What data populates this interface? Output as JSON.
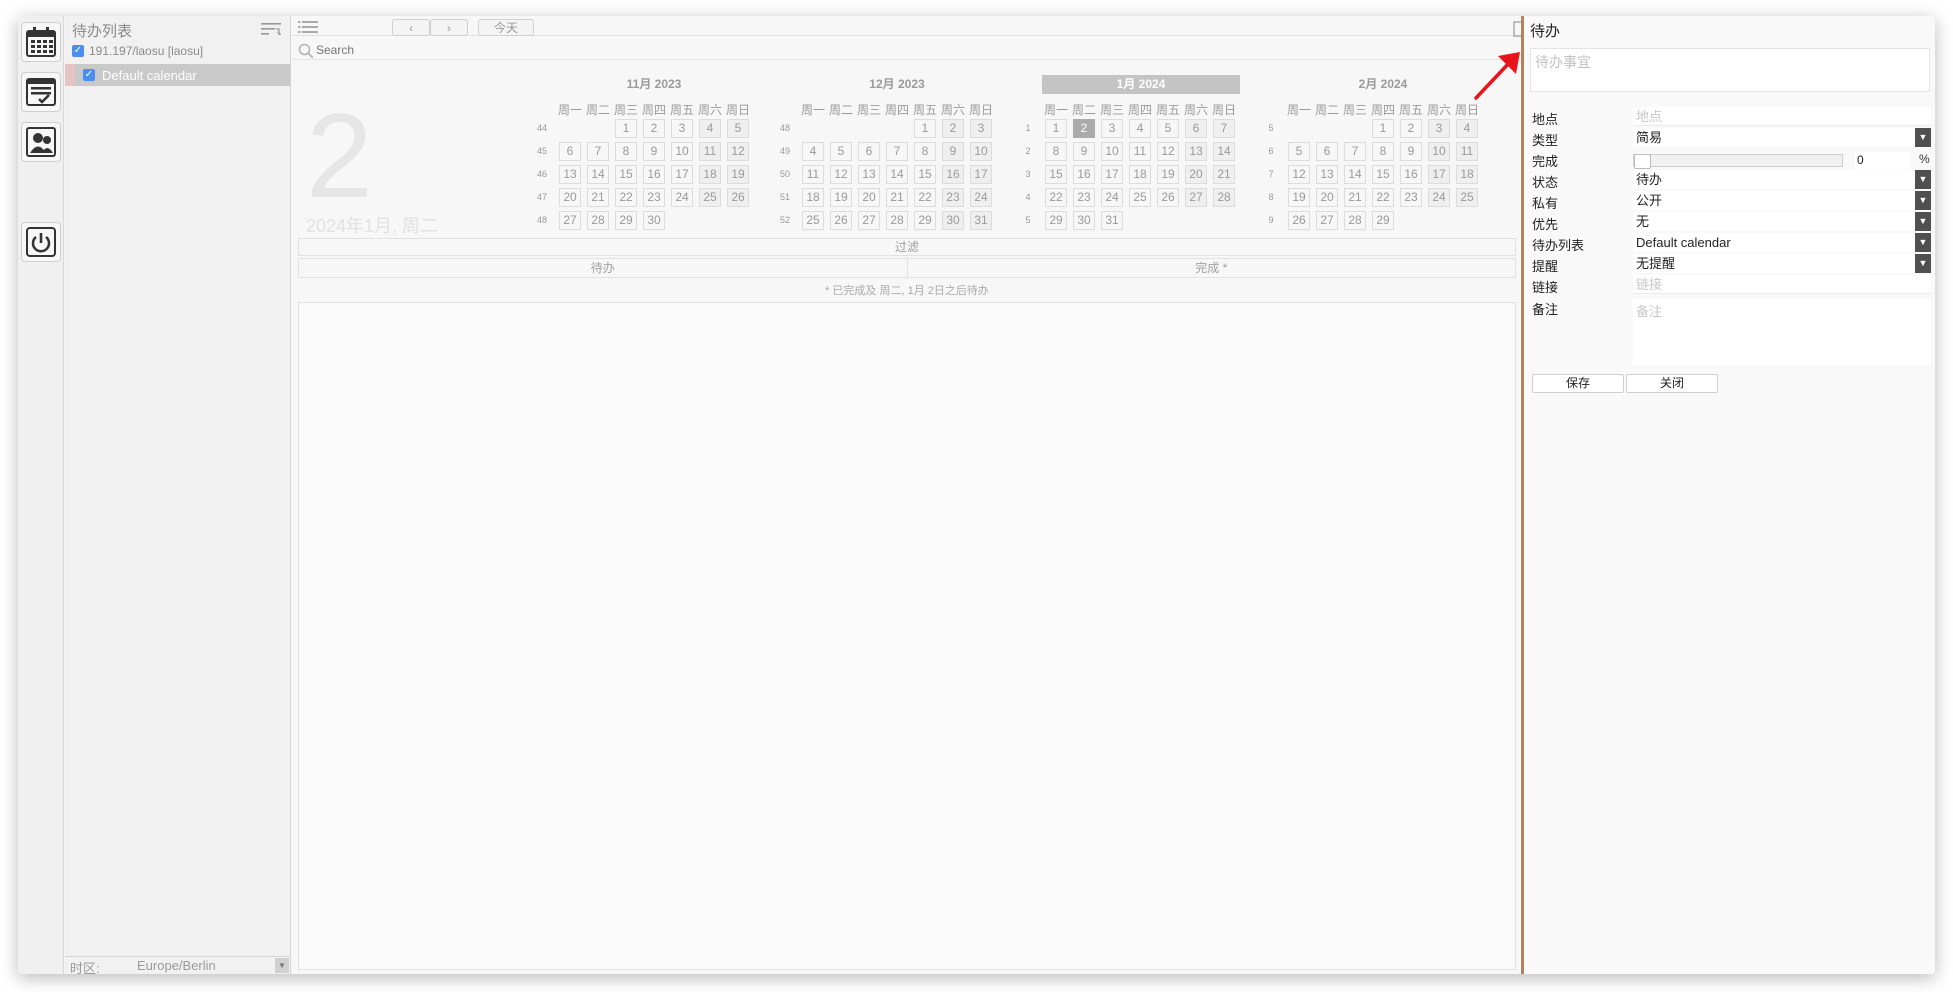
{
  "sidebar": {
    "title": "待办列表",
    "account": "191.197/laosu [laosu]",
    "calendar": "Default calendar",
    "timezone_label": "时区:",
    "timezone_value": "Europe/Berlin"
  },
  "toolbar": {
    "prev": "‹",
    "next": "›",
    "today": "今天"
  },
  "search": {
    "placeholder": "Search"
  },
  "big_date": {
    "day": "2",
    "full": "2024年1月, 周二"
  },
  "weekdays": [
    "周一",
    "周二",
    "周三",
    "周四",
    "周五",
    "周六",
    "周日"
  ],
  "months": [
    {
      "title": "11月 2023",
      "active": false,
      "weeks": [
        "44",
        "45",
        "46",
        "47",
        "48"
      ],
      "lead": 2,
      "days": 30,
      "today": null
    },
    {
      "title": "12月 2023",
      "active": false,
      "weeks": [
        "48",
        "49",
        "50",
        "51",
        "52"
      ],
      "lead": 4,
      "days": 31,
      "today": null
    },
    {
      "title": "1月 2024",
      "active": true,
      "weeks": [
        "1",
        "2",
        "3",
        "4",
        "5"
      ],
      "lead": 0,
      "days": 31,
      "today": 2
    },
    {
      "title": "2月 2024",
      "active": false,
      "weeks": [
        "5",
        "6",
        "7",
        "8",
        "9"
      ],
      "lead": 3,
      "days": 29,
      "today": null
    }
  ],
  "filter": {
    "title": "过滤",
    "tab_todo": "待办",
    "tab_done": "完成 *",
    "note": "* 已完成及 周二, 1月 2日之后待办"
  },
  "editor": {
    "title": "待办",
    "summary_placeholder": "待办事宜",
    "location_label": "地点",
    "location_placeholder": "地点",
    "type_label": "类型",
    "type_value": "简易",
    "done_label": "完成",
    "done_percent": 0,
    "done_value": "0",
    "done_unit": "%",
    "status_label": "状态",
    "status_value": "待办",
    "private_label": "私有",
    "private_value": "公开",
    "priority_label": "优先",
    "priority_value": "无",
    "list_label": "待办列表",
    "list_value": "Default calendar",
    "alarm_label": "提醒",
    "alarm_value": "无提醒",
    "link_label": "链接",
    "link_placeholder": "链接",
    "notes_label": "备注",
    "notes_placeholder": "备注",
    "save": "保存",
    "close": "关闭"
  },
  "colors": {
    "accent_divider": "#b3825e",
    "annotation_arrow": "#e8141c"
  }
}
